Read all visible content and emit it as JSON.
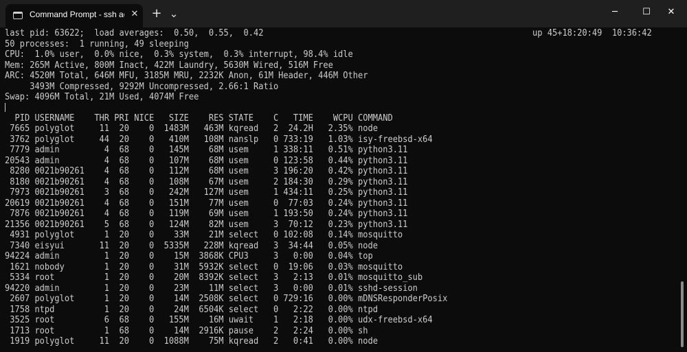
{
  "window": {
    "tab_title": "Command Prompt - ssh  admi",
    "tab_icon": "terminal-icon",
    "close_glyph": "✕",
    "new_tab_glyph": "+",
    "dropdown_glyph": "⌄",
    "minimize_glyph": "─",
    "maximize_glyph": "☐",
    "window_close_glyph": "✕"
  },
  "terminal": {
    "header_left": "last pid: 63622;  load averages:  0.50,  0.55,  0.42",
    "header_right": "up 45+18:20:49  10:36:42",
    "summary_lines": [
      "50 processes:  1 running, 49 sleeping",
      "CPU:  1.0% user,  0.0% nice,  0.3% system,  0.3% interrupt, 98.4% idle",
      "Mem: 265M Active, 800M Inact, 422M Laundry, 5630M Wired, 516M Free",
      "ARC: 4520M Total, 646M MFU, 3185M MRU, 2232K Anon, 61M Header, 446M Other",
      "     3493M Compressed, 9292M Uncompressed, 2.66:1 Ratio",
      "Swap: 4096M Total, 21M Used, 4074M Free"
    ],
    "table_header": "  PID USERNAME    THR PRI NICE   SIZE    RES STATE    C   TIME    WCPU COMMAND",
    "rows": [
      " 7665 polyglot     11  20    0  1483M   463M kqread   2  24.2H   2.35% node",
      " 3762 polyglot     44  20    0   410M   108M nanslp   0 733:19   1.03% isy-freebsd-x64",
      " 7779 admin         4  68    0   145M    68M usem     1 338:11   0.51% python3.11",
      "20543 admin         4  68    0   107M    68M usem     0 123:58   0.44% python3.11",
      " 8280 0021b90261    4  68    0   112M    68M usem     3 196:20   0.42% python3.11",
      " 8180 0021b90261    4  68    0   108M    67M usem     2 184:30   0.29% python3.11",
      " 7973 0021b90261    3  68    0   242M   127M usem     1 434:11   0.25% python3.11",
      "20619 0021b90261    4  68    0   151M    77M usem     0  77:03   0.24% python3.11",
      " 7876 0021b90261    4  68    0   119M    69M usem     1 193:50   0.24% python3.11",
      "21356 0021b90261    5  68    0   124M    82M usem     3  70:12   0.23% python3.11",
      " 4931 polyglot      1  20    0    33M    21M select   0 102:08   0.14% mosquitto",
      " 7340 eisyui       11  20    0  5335M   228M kqread   3  34:44   0.05% node",
      "94224 admin         1  20    0    15M  3868K CPU3     3   0:00   0.04% top",
      " 1621 nobody        1  20    0    31M  5932K select   0  19:06   0.03% mosquitto",
      " 5334 root          1  20    0    20M  8392K select   3   2:13   0.01% mosquitto_sub",
      "94220 admin         1  20    0    23M    11M select   3   0:00   0.01% sshd-session",
      " 2607 polyglot      1  20    0    14M  2508K select   0 729:16   0.00% mDNSResponderPosix",
      " 1758 ntpd          1  20    0    24M  6504K select   0   2:22   0.00% ntpd",
      " 3525 root          6  68    0   155M    16M uwait    1   2:18   0.00% udx-freebsd-x64",
      " 1713 root          1  68    0    14M  2916K pause    2   2:24   0.00% sh",
      " 1919 polyglot     11  20    0  1088M    75M kqread   2   0:41   0.00% node"
    ]
  }
}
